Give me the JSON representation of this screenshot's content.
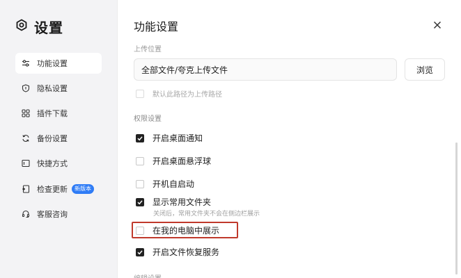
{
  "sidebar": {
    "title": "设置",
    "items": [
      {
        "label": "功能设置",
        "icon": "sliders-icon",
        "active": true
      },
      {
        "label": "隐私设置",
        "icon": "shield-icon",
        "active": false
      },
      {
        "label": "插件下载",
        "icon": "grid-icon",
        "active": false
      },
      {
        "label": "备份设置",
        "icon": "sync-icon",
        "active": false
      },
      {
        "label": "快捷方式",
        "icon": "shortcut-icon",
        "active": false
      },
      {
        "label": "检查更新",
        "icon": "update-icon",
        "active": false,
        "badge": "新版本"
      },
      {
        "label": "客服咨询",
        "icon": "headset-icon",
        "active": false
      }
    ]
  },
  "panel": {
    "title": "功能设置",
    "upload_location_label": "上传位置",
    "upload_path": "全部文件/夸克上传文件",
    "browse_label": "浏览",
    "default_path_label": "默认此路径为上传路径",
    "permissions_label": "权限设置",
    "options": [
      {
        "label": "开启桌面通知",
        "checked": true
      },
      {
        "label": "开启桌面悬浮球",
        "checked": false
      },
      {
        "label": "开机自启动",
        "checked": false
      },
      {
        "label": "显示常用文件夹",
        "checked": true
      },
      {
        "label": "在我的电脑中展示",
        "checked": false
      },
      {
        "label": "开启文件恢复服务",
        "checked": true
      }
    ],
    "common_folder_note": "关闭后，常用文件夹不会在侧边栏展示",
    "next_section_label": "编辑设置"
  },
  "colors": {
    "accent": "#2f7cf6",
    "highlight": "#c0392b",
    "checked": "#222222"
  }
}
